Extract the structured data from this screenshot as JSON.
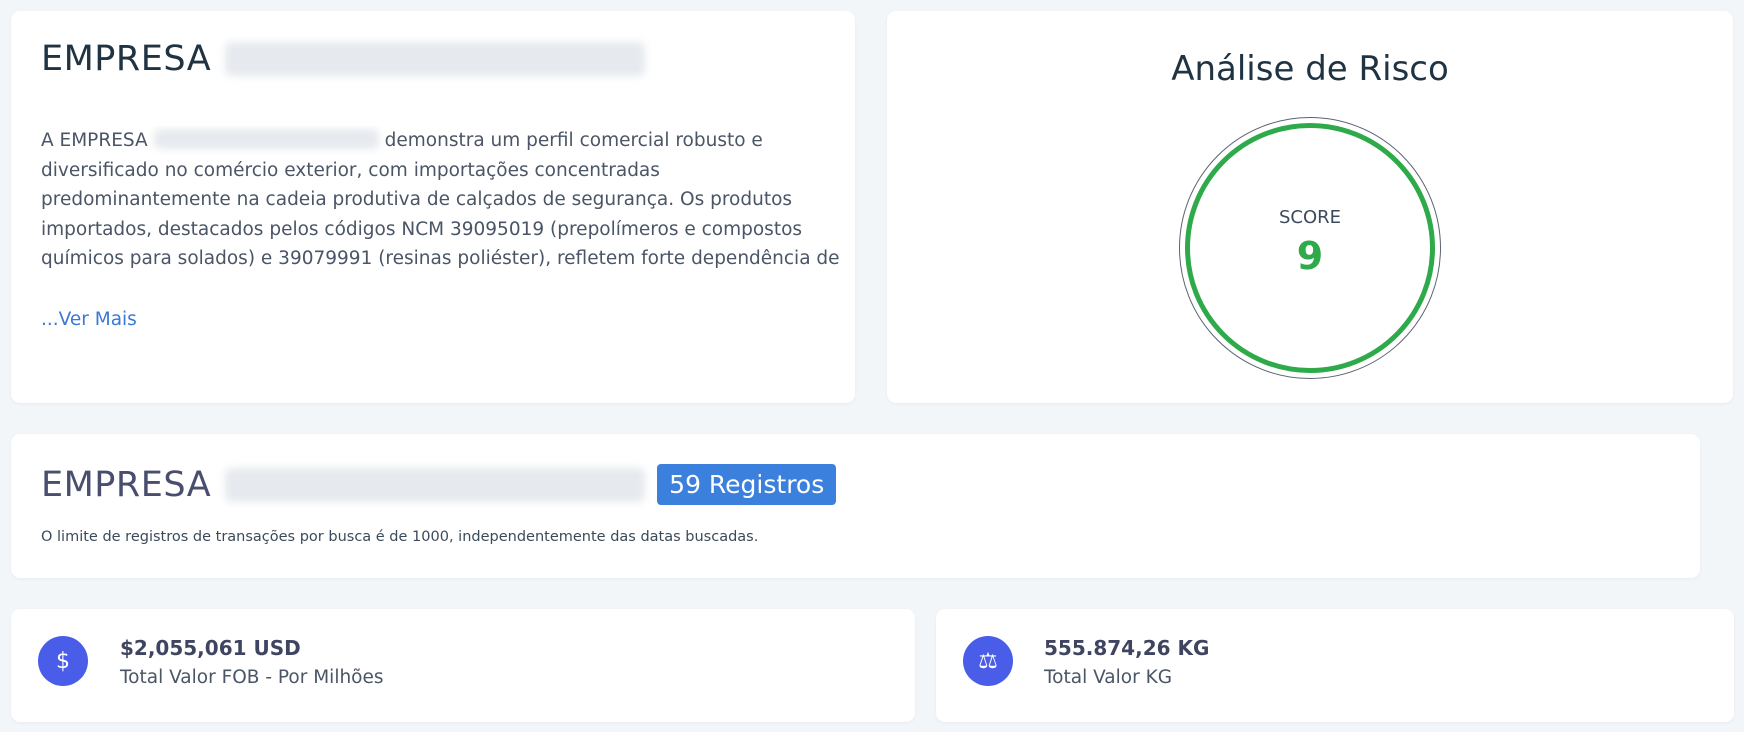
{
  "company": {
    "title_prefix": "EMPRESA",
    "description_prefix": "A EMPRESA",
    "description_body": "demonstra um perfil comercial robusto e diversificado no comércio exterior, com importações concentradas predominantemente na cadeia produtiva de calçados de segurança. Os produtos importados, destacados pelos códigos NCM 39095019 (prepolímeros e compostos químicos para solados) e 39079991 (resinas poliéster), refletem forte dependência de matérias-primas avançadas originárias da…",
    "ver_mais": "...Ver Mais"
  },
  "risk": {
    "title": "Análise de Risco",
    "score_label": "SCORE",
    "score_value": "9",
    "score_color": "#2eaa4a"
  },
  "records": {
    "title_prefix": "EMPRESA",
    "badge": "59 Registros",
    "badge_color": "#3b80dc",
    "note": "O limite de registros de transações por busca é de 1000, independentemente das datas buscadas."
  },
  "metrics": [
    {
      "icon": "dollar-icon",
      "glyph": "$",
      "value": "$2,055,061 USD",
      "label": "Total Valor FOB - Por Milhões"
    },
    {
      "icon": "scale-icon",
      "glyph": "⚖",
      "value": "555.874,26 KG",
      "label": "Total Valor KG"
    }
  ],
  "colors": {
    "accent_blue": "#4a5de8",
    "link": "#3a78d6",
    "background": "#f3f6f9"
  }
}
